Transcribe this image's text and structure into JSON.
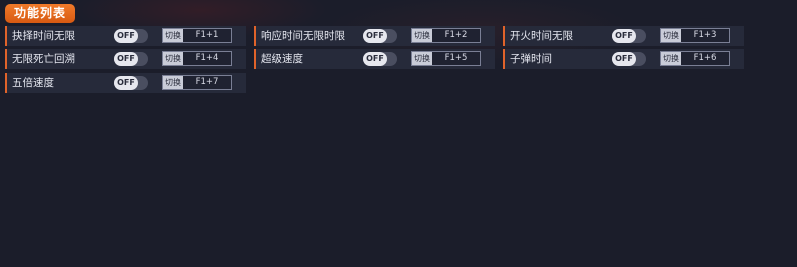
{
  "header": {
    "title": "功能列表"
  },
  "features": [
    {
      "label": "抉择时间无限",
      "toggle": "OFF",
      "switch_tag": "切换",
      "hotkey": "F1+1"
    },
    {
      "label": "响应时间无限时限",
      "toggle": "OFF",
      "switch_tag": "切换",
      "hotkey": "F1+2"
    },
    {
      "label": "开火时间无限",
      "toggle": "OFF",
      "switch_tag": "切换",
      "hotkey": "F1+3"
    },
    {
      "label": "无限死亡回溯",
      "toggle": "OFF",
      "switch_tag": "切换",
      "hotkey": "F1+4"
    },
    {
      "label": "超级速度",
      "toggle": "OFF",
      "switch_tag": "切换",
      "hotkey": "F1+5"
    },
    {
      "label": "子弹时间",
      "toggle": "OFF",
      "switch_tag": "切换",
      "hotkey": "F1+6"
    },
    {
      "label": "五倍速度",
      "toggle": "OFF",
      "switch_tag": "切换",
      "hotkey": "F1+7"
    }
  ],
  "colors": {
    "background": "#1b1d2a",
    "row_background": "#262a3a",
    "accent": "#e0632a",
    "badge": "#f07a2a"
  }
}
